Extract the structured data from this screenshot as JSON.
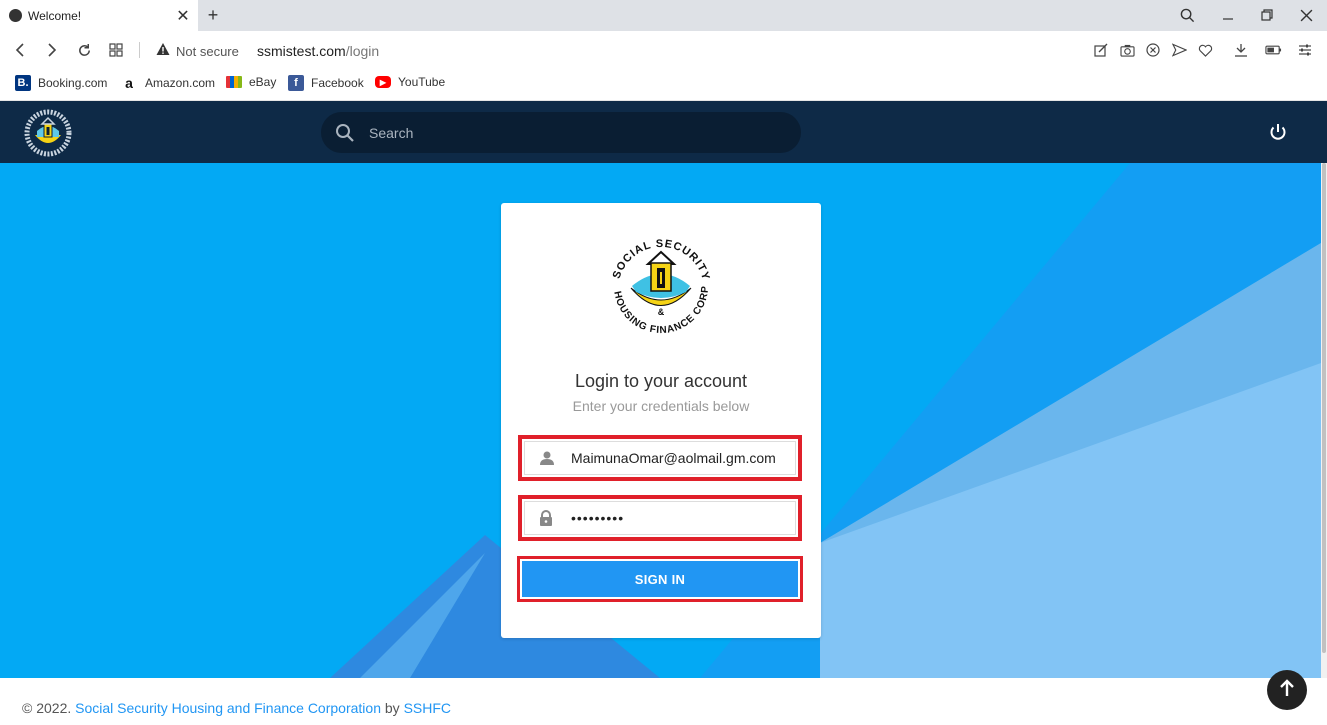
{
  "browser": {
    "tab_title": "Welcome!",
    "tab_close": "✕",
    "new_tab": "+",
    "not_secure": "Not secure",
    "url_host": "ssmistest.com",
    "url_path": "/login",
    "bookmarks": [
      {
        "label": "Booking.com",
        "icon": "B.",
        "color": "#003580"
      },
      {
        "label": "Amazon.com",
        "icon": "a",
        "color": "#ffffff"
      },
      {
        "label": "eBay",
        "icon": "",
        "color": "#e53238"
      },
      {
        "label": "Facebook",
        "icon": "f",
        "color": "#3b5998"
      },
      {
        "label": "YouTube",
        "icon": "▶",
        "color": "#ff0000"
      }
    ]
  },
  "app": {
    "search_placeholder": "Search",
    "login": {
      "title": "Login to your account",
      "subtitle": "Enter your credentials below",
      "username_value": "MaimunaOmar@aolmail.gm.com",
      "password_mask": "•••••••••",
      "signin_label": "SIGN IN"
    },
    "footer": {
      "prefix": "© 2022.",
      "org_link": "Social Security Housing and Finance Corporation",
      "by": "by",
      "brand_link": "SSHFC"
    }
  },
  "colors": {
    "header": "#0e2a47",
    "main_bg": "#03a9f4",
    "button": "#2196f3",
    "highlight": "#e0202a"
  }
}
